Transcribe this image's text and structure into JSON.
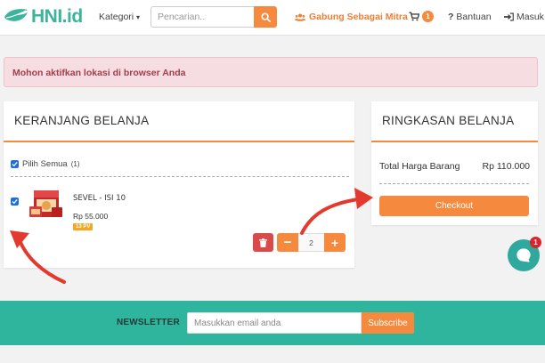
{
  "header": {
    "logo_text": "HNI.id",
    "kategori_label": "Kategori",
    "search_placeholder": "Pencarian..",
    "mitra_label": "Gabung Sebagai Mitra",
    "cart_count": "1",
    "bantuan_label": "Bantuan",
    "masuk_label": "Masuk",
    "accent_color": "#f58a3f",
    "brand_color": "#3bb49b"
  },
  "alert": {
    "message": "Mohon aktifkan lokasi di browser Anda"
  },
  "cart": {
    "title": "KERANJANG BELANJA",
    "select_all_label": "Pilih Semua",
    "select_all_count": "(1)",
    "items": [
      {
        "name": "SEVEL - ISI 10",
        "price": "Rp 55.000",
        "pv": "13 PV",
        "quantity": "2",
        "checked": true
      }
    ]
  },
  "summary": {
    "title": "RINGKASAN BELANJA",
    "total_label": "Total Harga Barang",
    "total_value": "Rp 110.000",
    "checkout_label": "Checkout"
  },
  "chat": {
    "badge": "1"
  },
  "newsletter": {
    "label": "NEWSLETTER",
    "placeholder": "Masukkan email anda",
    "subscribe_label": "Subscribe",
    "background_color": "#2fb59e"
  },
  "icons": [
    "leaf-logo-icon",
    "chevron-down-icon",
    "search-icon",
    "users-icon",
    "cart-icon",
    "question-icon",
    "sign-in-icon",
    "check-icon",
    "trash-icon",
    "chat-icon",
    "annotation-arrow-icon"
  ]
}
